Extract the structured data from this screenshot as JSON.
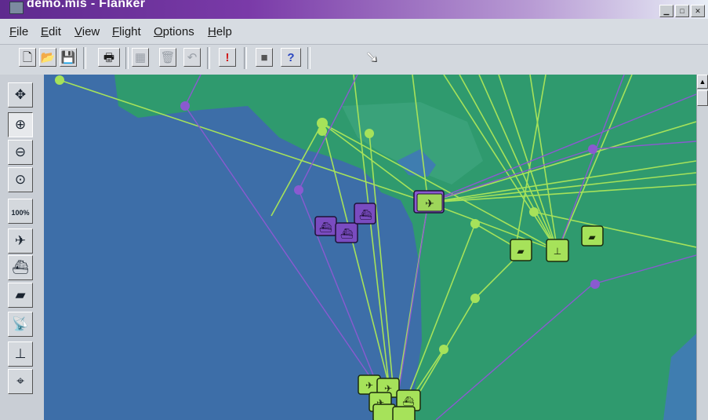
{
  "window": {
    "title": "demo.mis - Flanker",
    "min_glyph": "▁",
    "max_glyph": "□",
    "close_glyph": "✕"
  },
  "menu": {
    "file": "File",
    "edit": "Edit",
    "view": "View",
    "flight": "Flight",
    "options": "Options",
    "help": "Help"
  },
  "toolbar": {
    "new_glyph": "🗋",
    "open_glyph": "📂",
    "save_glyph": "💾",
    "print_glyph": "🖶",
    "grid_glyph": "▦",
    "delete_glyph": "🗑",
    "undo_glyph": "↶",
    "alert_glyph": "!",
    "stop_glyph": "■",
    "context_help_glyph": "?"
  },
  "tools": {
    "zoom_100_label": "100%"
  },
  "colors": {
    "sea": "#3d6ea8",
    "land": "#2f9a6e",
    "green_route": "#a6e25a",
    "purple_route": "#8a5ad0"
  },
  "icons": [
    "move-icon",
    "zoom-in-icon",
    "zoom-out-icon",
    "zoom-fit-icon",
    "zoom-100-icon",
    "aircraft-icon",
    "ship-icon",
    "tank-icon",
    "radar-icon",
    "airfield-icon",
    "target-icon"
  ]
}
